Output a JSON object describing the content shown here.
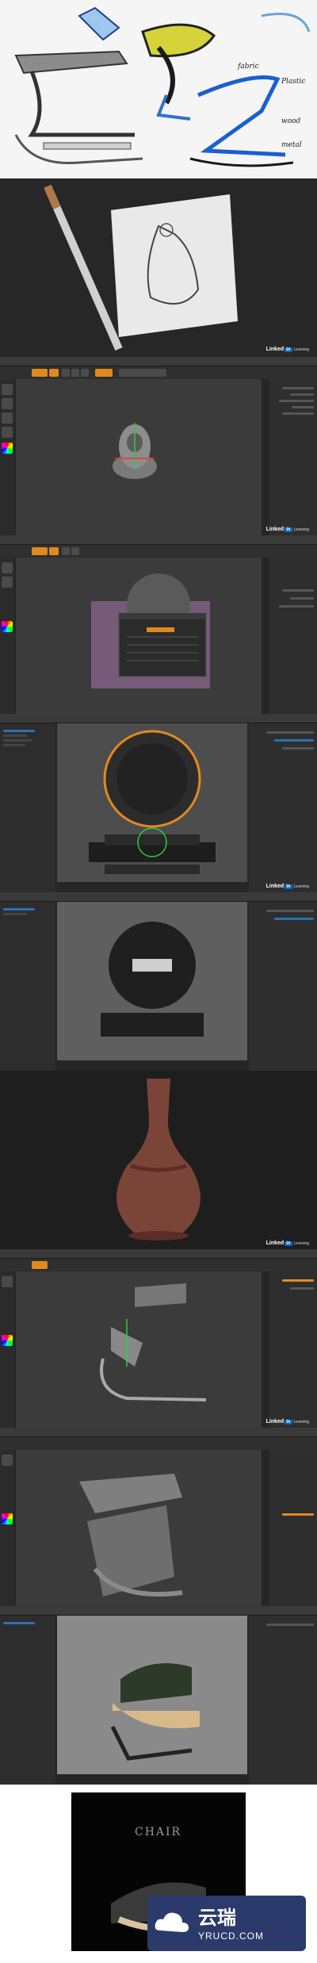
{
  "watermark": {
    "brand_cn": "云瑞",
    "domain": "YRUCD.COM"
  },
  "linkedin_badge": {
    "prefix": "Linked",
    "suffix": "in",
    "learning": "Learning"
  },
  "sketch_panel": {
    "labels": [
      "fabric",
      "Plastic",
      "wood",
      "metal"
    ]
  },
  "colors": {
    "accent_orange": "#e08a1e",
    "selection_blue": "#2d6fb0",
    "linkedin_blue": "#0a66c2"
  },
  "icons": [
    "pencil-icon",
    "color-picker-icon",
    "shelf-tool-icon"
  ],
  "render_panel_caption": "CHAIR"
}
